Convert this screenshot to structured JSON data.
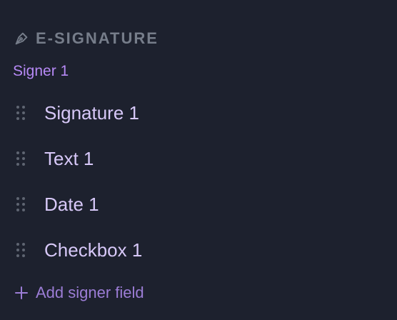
{
  "section": {
    "icon": "pen-nib-icon",
    "title": "E-SIGNATURE"
  },
  "signer": {
    "label": "Signer 1"
  },
  "fields": [
    {
      "label": "Signature 1",
      "icon": "drag-handle-icon"
    },
    {
      "label": "Text 1",
      "icon": "drag-handle-icon"
    },
    {
      "label": "Date 1",
      "icon": "drag-handle-icon"
    },
    {
      "label": "Checkbox 1",
      "icon": "drag-handle-icon"
    }
  ],
  "add_field": {
    "icon": "plus-icon",
    "label": "Add signer field"
  },
  "colors": {
    "background": "#1d212e",
    "section_title": "#767d8a",
    "signer_label": "#b689f5",
    "field_label": "#d7c8f8",
    "add_field": "#9c7dd6",
    "drag_handle": "#5f6572"
  }
}
